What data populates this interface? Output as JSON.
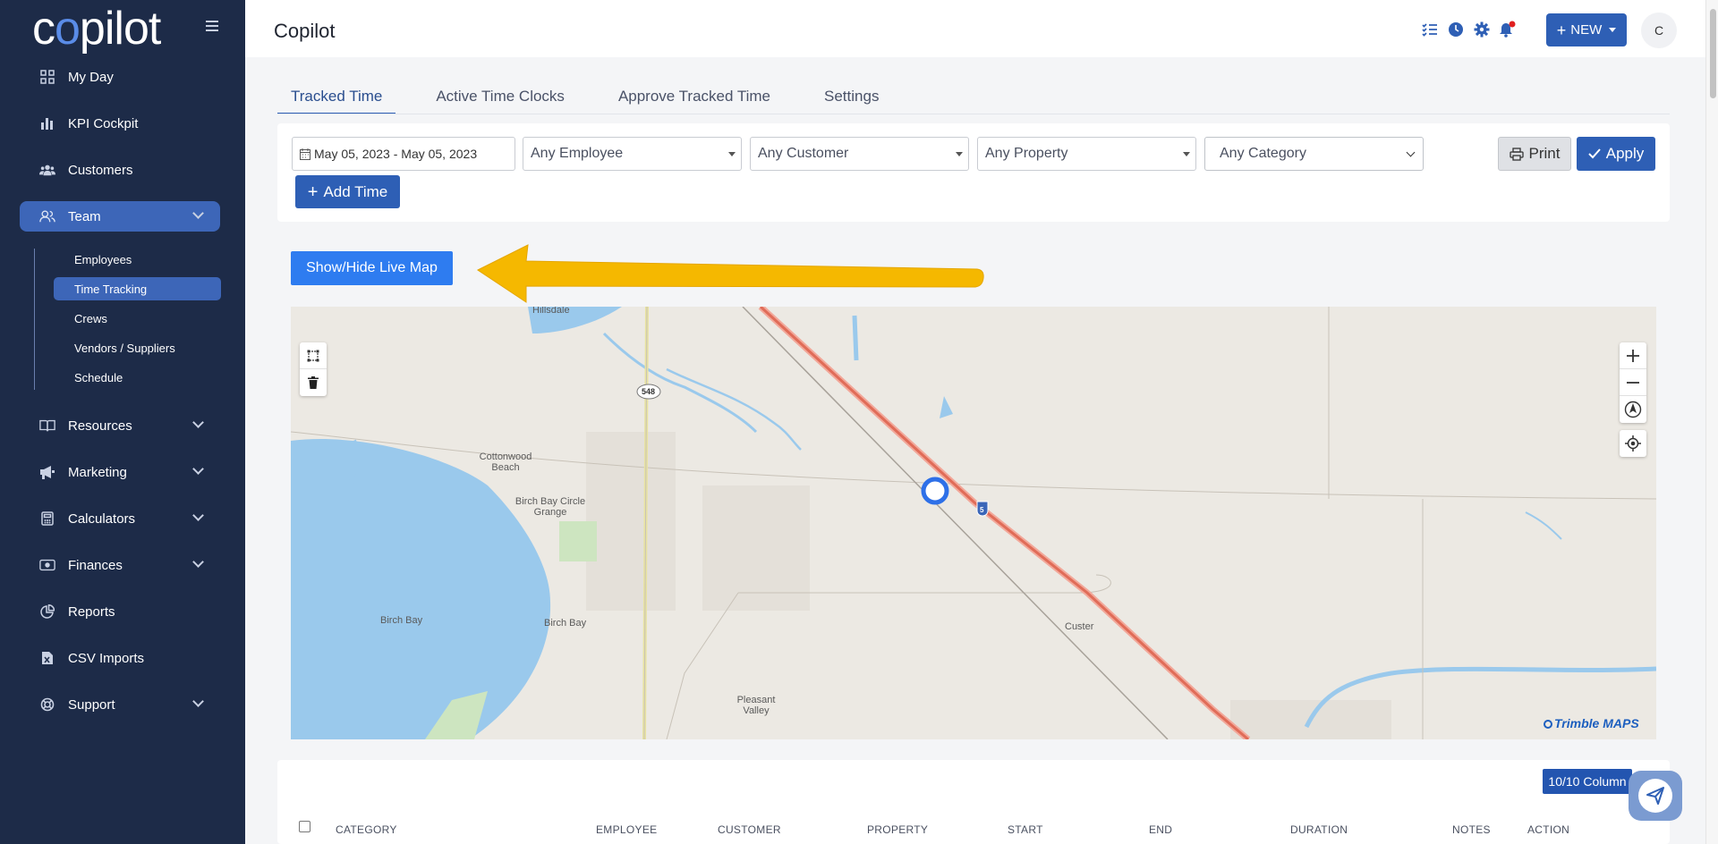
{
  "brand": {
    "logo_prefix": "c",
    "logo_o": "o",
    "logo_suffix": "pilot"
  },
  "sidebar": {
    "items": [
      {
        "label": "My Day",
        "icon": "grid-icon"
      },
      {
        "label": "KPI Cockpit",
        "icon": "bar-chart-icon"
      },
      {
        "label": "Customers",
        "icon": "users-icon"
      },
      {
        "label": "Team",
        "icon": "user-team-icon",
        "active": true
      },
      {
        "label": "Resources",
        "icon": "book-icon"
      },
      {
        "label": "Marketing",
        "icon": "megaphone-icon"
      },
      {
        "label": "Calculators",
        "icon": "calculator-icon"
      },
      {
        "label": "Finances",
        "icon": "money-icon"
      },
      {
        "label": "Reports",
        "icon": "pie-chart-icon"
      },
      {
        "label": "CSV Imports",
        "icon": "csv-file-icon"
      },
      {
        "label": "Support",
        "icon": "lifebuoy-icon"
      }
    ],
    "team_sub": [
      "Employees",
      "Time Tracking",
      "Crews",
      "Vendors / Suppliers",
      "Schedule"
    ]
  },
  "header": {
    "title": "Copilot",
    "new_label": "NEW",
    "avatar_initial": "C"
  },
  "tabs": [
    "Tracked Time",
    "Active Time Clocks",
    "Approve Tracked Time",
    "Settings"
  ],
  "filters": {
    "date_range": "May 05, 2023 - May 05, 2023",
    "employee": "Any Employee",
    "customer": "Any Customer",
    "property": "Any Property",
    "category": "Any Category",
    "print_label": "Print",
    "apply_label": "Apply",
    "add_time_label": "Add Time"
  },
  "map": {
    "toggle_label": "Show/Hide Live Map",
    "places": [
      "Hillsdale",
      "548",
      "Cottonwood Beach",
      "Birch Bay Circle Grange",
      "Birch Bay",
      "Birch Bay",
      "Custer",
      "Pleasant Valley",
      "5"
    ],
    "attribution": "Trimble MAPS"
  },
  "table": {
    "columns_label": "10/10 Column",
    "headers": [
      "CATEGORY",
      "EMPLOYEE",
      "CUSTOMER",
      "PROPERTY",
      "START",
      "END",
      "DURATION",
      "NOTES",
      "ACTION"
    ]
  },
  "colors": {
    "sidebar_bg": "#1d2b48",
    "primary": "#2e5fb5",
    "active_nav": "#3d66b8",
    "arrow": "#f5b800"
  }
}
